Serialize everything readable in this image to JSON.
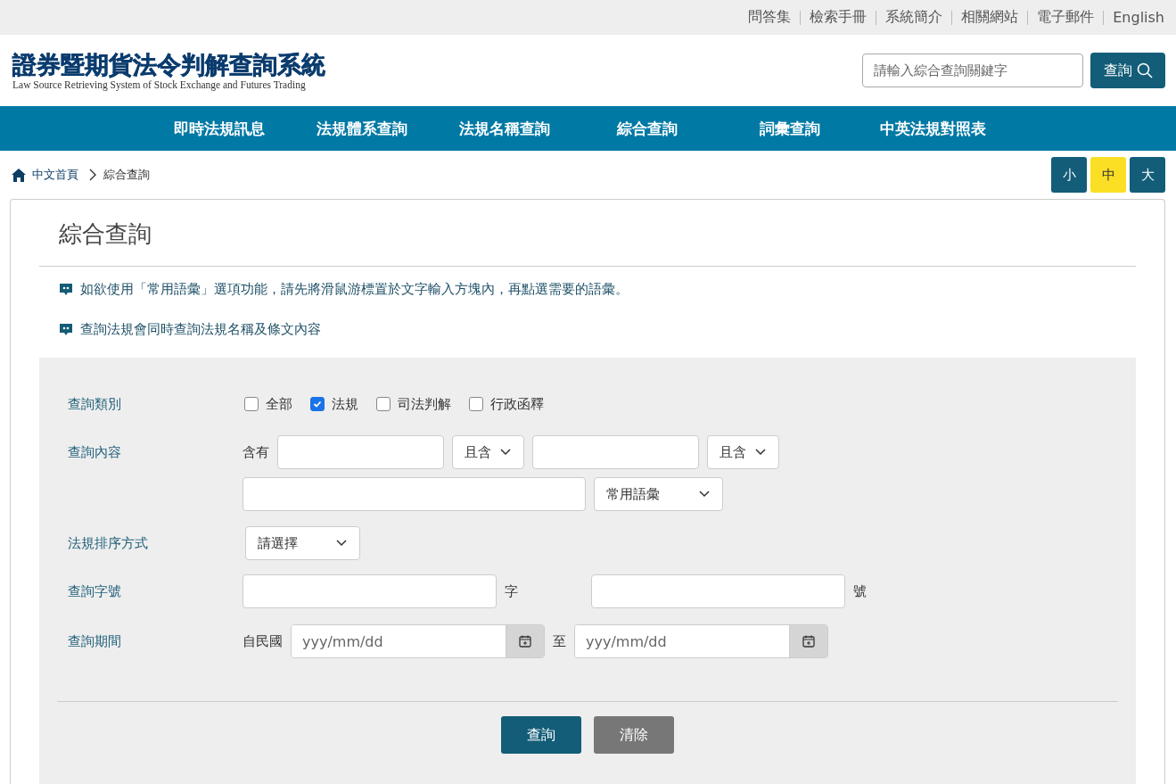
{
  "top_links": [
    "問答集",
    "檢索手冊",
    "系統簡介",
    "相關網站",
    "電子郵件",
    "English"
  ],
  "logo": {
    "title": "證券暨期貨法令判解查詢系統",
    "subtitle": "Law Source Retrieving System of Stock Exchange and Futures Trading"
  },
  "search": {
    "placeholder": "請輸入綜合查詢關鍵字",
    "button": "查詢"
  },
  "nav": [
    "即時法規訊息",
    "法規體系查詢",
    "法規名稱查詢",
    "綜合查詢",
    "詞彙查詢",
    "中英法規對照表"
  ],
  "breadcrumb": [
    "中文首頁",
    "綜合查詢"
  ],
  "font_sizes": [
    {
      "label": "小",
      "selected": false
    },
    {
      "label": "中",
      "selected": true
    },
    {
      "label": "大",
      "selected": false
    }
  ],
  "page_title": "綜合查詢",
  "notes": [
    "如欲使用「常用語彙」選項功能，請先將滑鼠游標置於文字輸入方塊內，再點選需要的語彙。",
    "查詢法規會同時查詢法規名稱及條文內容"
  ],
  "form": {
    "category": {
      "label": "查詢類別",
      "options": [
        {
          "label": "全部",
          "checked": false
        },
        {
          "label": "法規",
          "checked": true
        },
        {
          "label": "司法判解",
          "checked": false
        },
        {
          "label": "行政函釋",
          "checked": false
        }
      ]
    },
    "content": {
      "label": "查詢內容",
      "prefix": "含有",
      "selects": [
        "且含",
        "且含"
      ],
      "phrase_select": "常用語彙"
    },
    "sort": {
      "label": "法規排序方式",
      "select": "請選擇"
    },
    "number": {
      "label": "查詢字號",
      "suffix_1": "字",
      "suffix_2": "號"
    },
    "period": {
      "label": "查詢期間",
      "prefix": "自民國",
      "from_placeholder": "yyy/mm/dd",
      "middle": "至",
      "to_placeholder": "yyy/mm/dd"
    }
  },
  "buttons": [
    {
      "label": "查詢",
      "kind": "primary"
    },
    {
      "label": "清除",
      "kind": "secondary"
    }
  ]
}
